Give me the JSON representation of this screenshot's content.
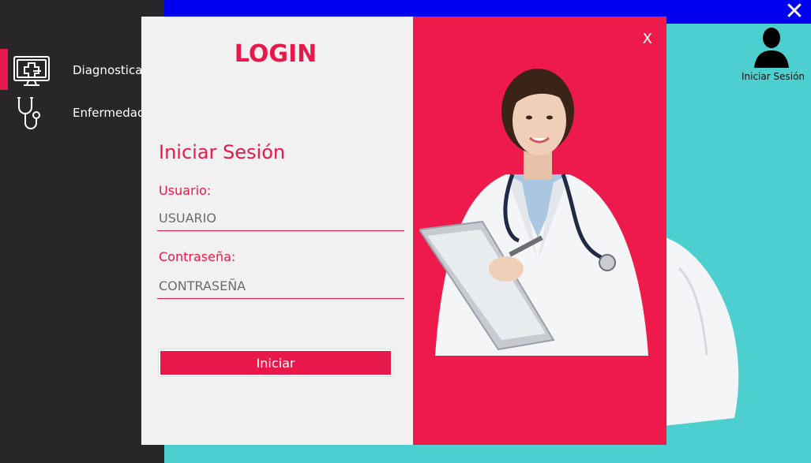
{
  "window": {
    "close_glyph": "✕"
  },
  "sidebar": {
    "items": [
      {
        "label": "Diagnostica",
        "icon": "medical-monitor-icon"
      },
      {
        "label": "Enfermedad",
        "icon": "stethoscope-icon"
      }
    ]
  },
  "user": {
    "label": "Iniciar Sesión",
    "icon": "user-silhouette-icon"
  },
  "modal": {
    "title": "LOGIN",
    "close_label": "X",
    "section_title": "Iniciar Sesión",
    "username_label": "Usuario:",
    "username_placeholder": "USUARIO",
    "password_label": "Contraseña:",
    "password_placeholder": "CONTRASEÑA",
    "submit_label": "Iniciar"
  },
  "colors": {
    "accent": "#e8184a",
    "sidebar_bg": "#282628",
    "topbar": "#0000f0",
    "background": "#4ecfcf",
    "modal_left_bg": "#f1f1f1",
    "modal_right_bg": "#ee1a4b"
  }
}
